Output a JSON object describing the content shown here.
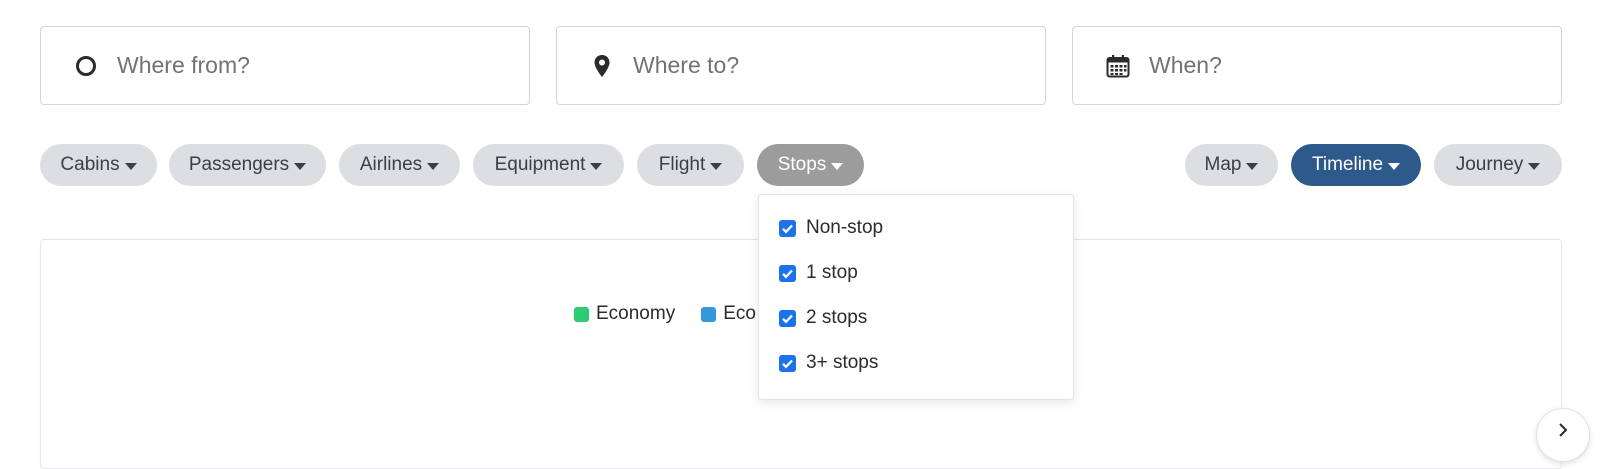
{
  "search": {
    "from_placeholder": "Where from?",
    "to_placeholder": "Where to?",
    "when_placeholder": "When?"
  },
  "filters": {
    "cabins": "Cabins",
    "passengers": "Passengers",
    "airlines": "Airlines",
    "equipment": "Equipment",
    "flight": "Flight",
    "stops": "Stops"
  },
  "views": {
    "map": "Map",
    "timeline": "Timeline",
    "journey": "Journey"
  },
  "stops_menu": {
    "options": [
      {
        "label": "Non-stop",
        "checked": true
      },
      {
        "label": "1 stop",
        "checked": true
      },
      {
        "label": "2 stops",
        "checked": true
      },
      {
        "label": "3+ stops",
        "checked": true
      }
    ]
  },
  "legend": {
    "items": [
      {
        "label": "Economy",
        "color": "#2ecc71"
      },
      {
        "label": "Eco",
        "color": "#3498db"
      }
    ]
  },
  "colors": {
    "active_view": "#2d5a8a",
    "active_filter": "#9c9c9c",
    "chip": "#dcdee2",
    "checkbox": "#1a73e8"
  }
}
